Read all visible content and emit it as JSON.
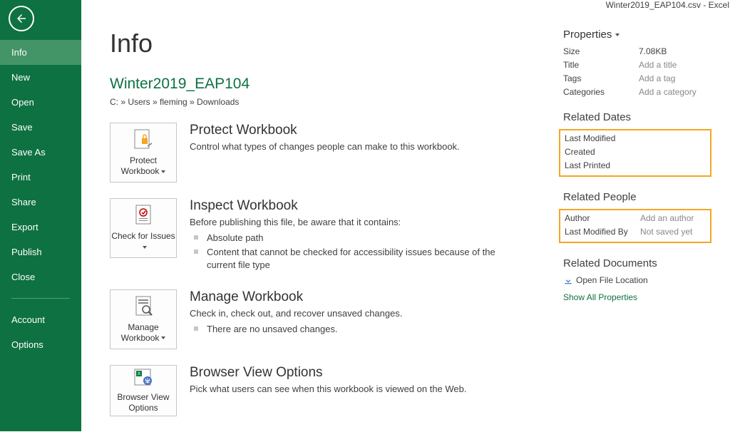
{
  "titlebar": "Winter2019_EAP104.csv - Excel",
  "sidebar": {
    "items": [
      "Info",
      "New",
      "Open",
      "Save",
      "Save As",
      "Print",
      "Share",
      "Export",
      "Publish",
      "Close"
    ],
    "bottom": [
      "Account",
      "Options"
    ],
    "active": "Info"
  },
  "page": {
    "title": "Info",
    "doc_name": "Winter2019_EAP104",
    "doc_path": "C: » Users » fleming » Downloads"
  },
  "sections": {
    "protect": {
      "btn": "Protect Workbook",
      "head": "Protect Workbook",
      "desc": "Control what types of changes people can make to this workbook."
    },
    "inspect": {
      "btn": "Check for Issues",
      "head": "Inspect Workbook",
      "desc": "Before publishing this file, be aware that it contains:",
      "bullets": [
        "Absolute path",
        "Content that cannot be checked for accessibility issues because of the current file type"
      ]
    },
    "manage": {
      "btn": "Manage Workbook",
      "head": "Manage Workbook",
      "desc": "Check in, check out, and recover unsaved changes.",
      "bullets": [
        "There are no unsaved changes."
      ]
    },
    "browser": {
      "btn": "Browser View Options",
      "head": "Browser View Options",
      "desc": "Pick what users can see when this workbook is viewed on the Web."
    }
  },
  "props": {
    "head": "Properties",
    "rows": [
      {
        "label": "Size",
        "value": "7.08KB"
      },
      {
        "label": "Title",
        "value": "Add a title",
        "ph": true
      },
      {
        "label": "Tags",
        "value": "Add a tag",
        "ph": true
      },
      {
        "label": "Categories",
        "value": "Add a category",
        "ph": true
      }
    ],
    "dates_head": "Related Dates",
    "dates": [
      {
        "label": "Last Modified",
        "value": ""
      },
      {
        "label": "Created",
        "value": ""
      },
      {
        "label": "Last Printed",
        "value": ""
      }
    ],
    "people_head": "Related People",
    "people": [
      {
        "label": "Author",
        "value": "Add an author",
        "ph": true
      },
      {
        "label": "Last Modified By",
        "value": "Not saved yet",
        "ph": true
      }
    ],
    "docs_head": "Related Documents",
    "open_loc": "Open File Location",
    "show_all": "Show All Properties"
  }
}
